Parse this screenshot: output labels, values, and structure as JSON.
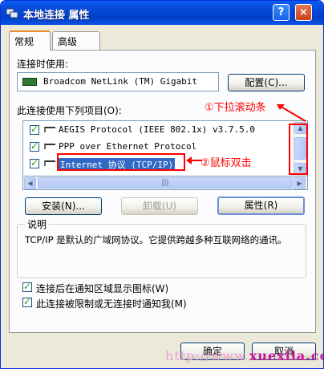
{
  "window": {
    "title": "本地连接 属性",
    "help_button": "?",
    "close_button": "×"
  },
  "tabs": [
    {
      "label": "常规",
      "active": true
    },
    {
      "label": "高级",
      "active": false
    }
  ],
  "connect_using": {
    "label": "连接时使用:",
    "adapter": "Broadcom NetLink (TM) Gigabit",
    "configure_button": "配置(C)..."
  },
  "items": {
    "label": "此连接使用下列项目(O):",
    "list": [
      {
        "checked": true,
        "text": "AEGIS Protocol (IEEE 802.1x) v3.7.5.0",
        "selected": false
      },
      {
        "checked": true,
        "text": "PPP over Ethernet Protocol",
        "selected": false
      },
      {
        "checked": true,
        "text": "Internet 协议 (TCP/IP)",
        "selected": true
      }
    ]
  },
  "buttons": {
    "install": "安装(N)...",
    "uninstall": "卸载(U)",
    "properties": "属性(R)"
  },
  "description": {
    "title": "说明",
    "text": "TCP/IP 是默认的广域网协议。它提供跨越多种互联网络的通讯。"
  },
  "options": [
    {
      "label": "连接后在通知区域显示图标(W)",
      "checked": true
    },
    {
      "label": "此连接被限制或无连接时通知我(M)",
      "checked": true
    }
  ],
  "footer": {
    "ok": "确定",
    "cancel": "取消"
  },
  "annotations": {
    "scroll_hint": "①下拉滚动条",
    "double_click_hint": "②鼠标双击"
  },
  "watermark": {
    "prefix": "http://www.",
    "domain": "xuexila.com"
  },
  "colors": {
    "annotation_red": "#ff0000",
    "titlebar_blue": "#0548d6",
    "selection_blue": "#316ac5"
  }
}
